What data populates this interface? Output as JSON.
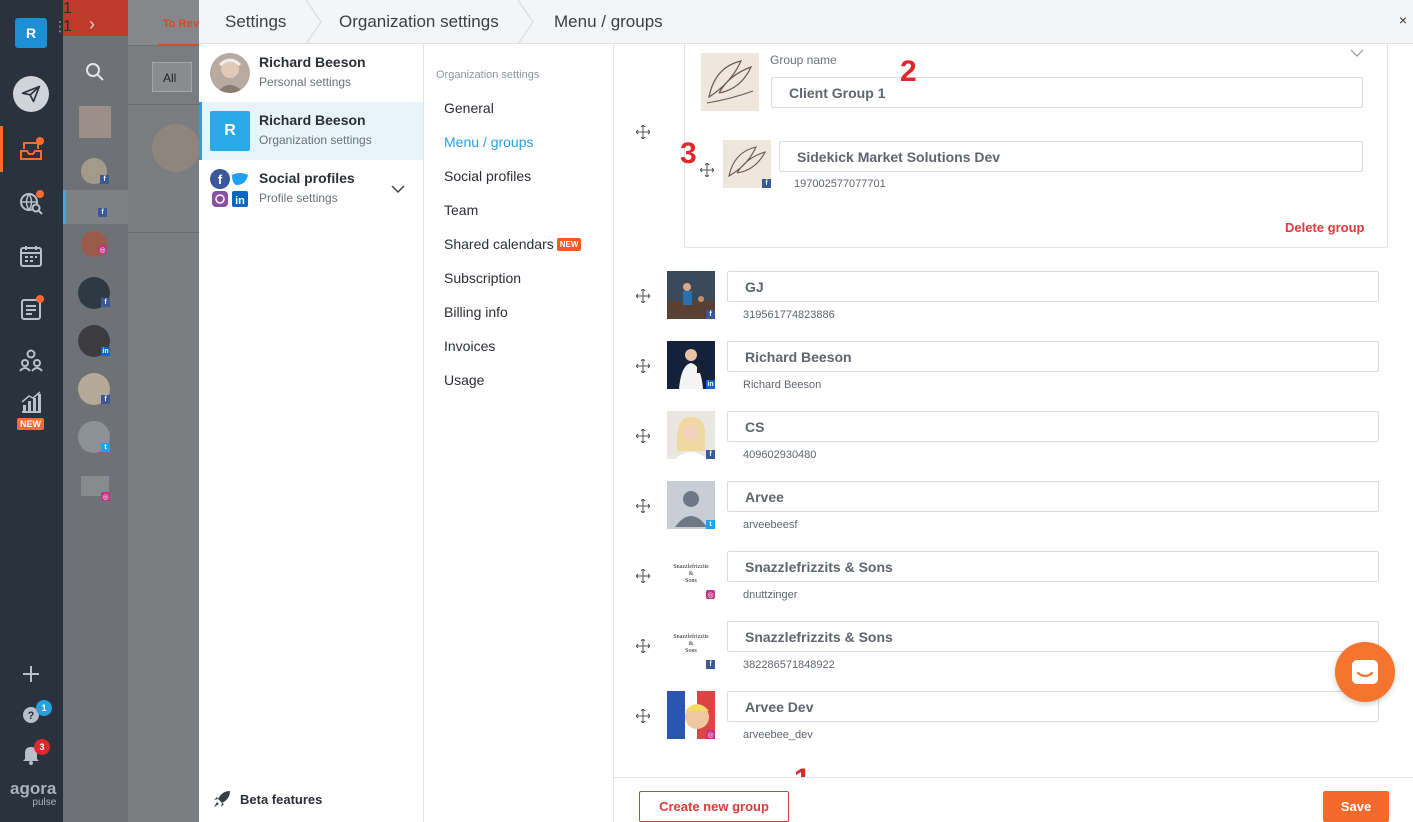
{
  "rail": {
    "logo_letter": "R",
    "new_tag": "NEW",
    "help_badge": "1",
    "notif_badge": "3",
    "brand": "agora",
    "brand_sub": "pulse"
  },
  "col2": {
    "badge_1": "1",
    "badge_2": "1"
  },
  "col3": {
    "tab_label": "To Rev",
    "filter_label": "All"
  },
  "breadcrumb": {
    "items": [
      "Settings",
      "Organization settings",
      "Menu / groups"
    ],
    "close_glyph": "×"
  },
  "profiles": [
    {
      "name": "Richard Beeson",
      "sub": "Personal settings"
    },
    {
      "name": "Richard Beeson",
      "sub": "Organization settings",
      "letter": "R"
    },
    {
      "name": "Social profiles",
      "sub": "Profile settings"
    }
  ],
  "beta_label": "Beta features",
  "menu": {
    "heading": "Organization settings",
    "items": [
      "General",
      "Menu / groups",
      "Social profiles",
      "Team",
      "Shared calendars",
      "Subscription",
      "Billing info",
      "Invoices",
      "Usage"
    ],
    "new_tag": "NEW"
  },
  "group": {
    "name_label": "Group name",
    "name_value": "Client Group 1",
    "member": {
      "name": "Sidekick Market Solutions Dev",
      "id": "197002577077701",
      "network": "facebook"
    },
    "delete_label": "Delete group"
  },
  "accounts": [
    {
      "name": "GJ",
      "sub": "319561774823886",
      "network": "facebook"
    },
    {
      "name": "Richard Beeson",
      "sub": "Richard Beeson",
      "network": "linkedin"
    },
    {
      "name": "CS",
      "sub": "409602930480",
      "network": "facebook"
    },
    {
      "name": "Arvee",
      "sub": "arveebeesf",
      "network": "twitter"
    },
    {
      "name": "Snazzlefrizzits & Sons",
      "sub": "dnuttzinger",
      "network": "instagram"
    },
    {
      "name": "Snazzlefrizzits & Sons",
      "sub": "382286571848922",
      "network": "facebook"
    },
    {
      "name": "Arvee Dev",
      "sub": "arveebee_dev",
      "network": "instagram"
    }
  ],
  "snazz_logo_text": [
    "Snazzlefrizzits",
    "&",
    "Sons"
  ],
  "annotations": [
    "1",
    "2",
    "3"
  ],
  "footer": {
    "create_label": "Create new group",
    "save_label": "Save"
  },
  "colors": {
    "accent_blue": "#2a9fe0",
    "accent_orange": "#f56a2a",
    "danger_red": "#e03a3a",
    "rail_bg": "#29323d"
  }
}
